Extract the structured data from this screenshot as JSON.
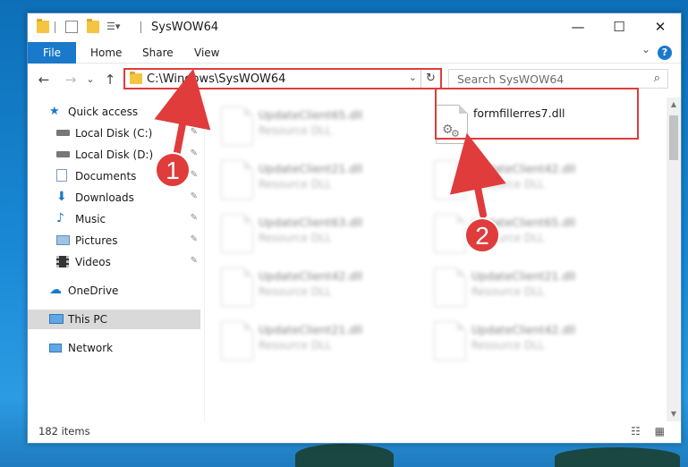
{
  "window": {
    "title": "SysWOW64",
    "minimize_glyph": "—",
    "maximize_glyph": "☐",
    "close_glyph": "✕"
  },
  "ribbon": {
    "tabs": [
      "File",
      "Home",
      "Share",
      "View"
    ],
    "expand_glyph": "⌄",
    "help_glyph": "?"
  },
  "navigation": {
    "back_glyph": "←",
    "forward_glyph": "→",
    "recent_glyph": "⌄",
    "up_glyph": "↑",
    "address_path": "C:\\Windows\\SysWOW64",
    "address_dropdown_glyph": "⌄",
    "refresh_glyph": "↻",
    "search_placeholder": "Search SysWOW64",
    "search_glyph": "⌕"
  },
  "sidebar": {
    "items": [
      {
        "label": "Quick access",
        "icon": "star-icon",
        "pinned": false
      },
      {
        "label": "Local Disk (C:)",
        "icon": "drive-icon",
        "pinned": true
      },
      {
        "label": "Local Disk (D:)",
        "icon": "drive-icon",
        "pinned": true
      },
      {
        "label": "Documents",
        "icon": "documents-icon",
        "pinned": true
      },
      {
        "label": "Downloads",
        "icon": "downloads-icon",
        "pinned": true
      },
      {
        "label": "Music",
        "icon": "music-icon",
        "pinned": true
      },
      {
        "label": "Pictures",
        "icon": "pictures-icon",
        "pinned": true
      },
      {
        "label": "Videos",
        "icon": "videos-icon",
        "pinned": true
      },
      {
        "label": "OneDrive",
        "icon": "cloud-icon",
        "pinned": false
      },
      {
        "label": "This PC",
        "icon": "computer-icon",
        "pinned": false,
        "selected": true
      },
      {
        "label": "Network",
        "icon": "network-icon",
        "pinned": false
      }
    ],
    "pin_glyph": "📌"
  },
  "files": {
    "highlighted": {
      "name": "formfillerres7.dll",
      "type": ""
    },
    "blurred": [
      {
        "name": "UpdateClient65.dll",
        "type": "Resource DLL"
      },
      {
        "name": "UpdateClient21.dll",
        "type": "Resource DLL"
      },
      {
        "name": "UpdateClient42.dll",
        "type": "Resource DLL"
      },
      {
        "name": "UpdateClient63.dll",
        "type": "Resource DLL"
      },
      {
        "name": "UpdateClient65.dll",
        "type": "Resource DLL"
      },
      {
        "name": "UpdateClient42.dll",
        "type": "Resource DLL"
      },
      {
        "name": "UpdateClient21.dll",
        "type": "Resource DLL"
      },
      {
        "name": "UpdateClient21.dll",
        "type": "Resource DLL"
      },
      {
        "name": "UpdateClient42.dll",
        "type": "Resource DLL"
      }
    ]
  },
  "status": {
    "item_count": "182 items",
    "view_glyphs": "☷ ▦"
  },
  "annotations": {
    "marker1": "1",
    "marker2": "2",
    "color": "#e03c3c"
  }
}
